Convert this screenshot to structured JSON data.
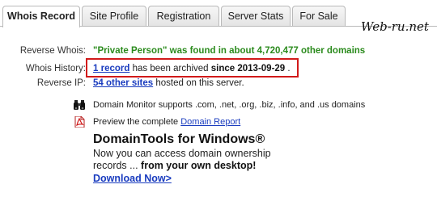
{
  "tabs": [
    {
      "label": "Whois Record",
      "active": true
    },
    {
      "label": "Site Profile",
      "active": false
    },
    {
      "label": "Registration",
      "active": false
    },
    {
      "label": "Server Stats",
      "active": false
    },
    {
      "label": "For Sale",
      "active": false
    }
  ],
  "watermark": "Web-ru.net",
  "info": {
    "reverse_whois": {
      "label": "Reverse Whois:",
      "value": "\"Private Person\" was found in about 4,720,477 other domains"
    },
    "whois_history": {
      "label": "Whois History:",
      "link": "1 record",
      "middle": " has been archived ",
      "since": "since 2013-09-29",
      "end": " ."
    },
    "reverse_ip": {
      "label": "Reverse IP:",
      "link": "54 other sites",
      "rest": " hosted on this server."
    }
  },
  "features": {
    "monitor": {
      "icon": "binoculars-icon",
      "text": "Domain Monitor supports .com, .net, .org, .biz, .info, and .us domains"
    },
    "report": {
      "icon": "pdf-icon",
      "prefix": "Preview the complete ",
      "link": "Domain Report"
    }
  },
  "promo": {
    "title": "DomainTools for Windows®",
    "line1": "Now you can access domain ownership",
    "line2_prefix": "records ... ",
    "line2_bold": "from your own desktop!",
    "download": "Download Now>"
  },
  "colors": {
    "highlight_border": "#d11a1a",
    "link": "#1a3cbf",
    "green": "#2b8b1d"
  }
}
